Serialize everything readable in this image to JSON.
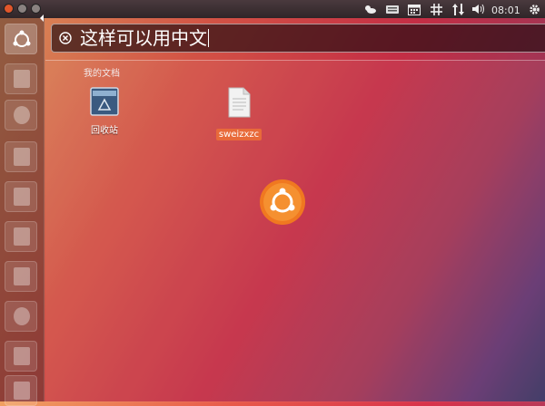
{
  "top_panel": {
    "clock": "08:01",
    "indicators": [
      "weather-icon",
      "keyboard-icon",
      "calendar-icon",
      "network-grid-icon",
      "transfer-icon",
      "volume-icon",
      "gear-icon"
    ]
  },
  "dash": {
    "search_value": "这样可以用中文",
    "folder_label": "我的文档"
  },
  "desktop": {
    "icons": [
      {
        "label": "回收站"
      },
      {
        "label": "sweizxzc"
      }
    ]
  },
  "launcher": {
    "items": [
      "dash-home",
      "files",
      "firefox",
      "writer",
      "calc",
      "impress",
      "software-center",
      "ubuntu-one",
      "workspace-switcher",
      "trash"
    ]
  }
}
